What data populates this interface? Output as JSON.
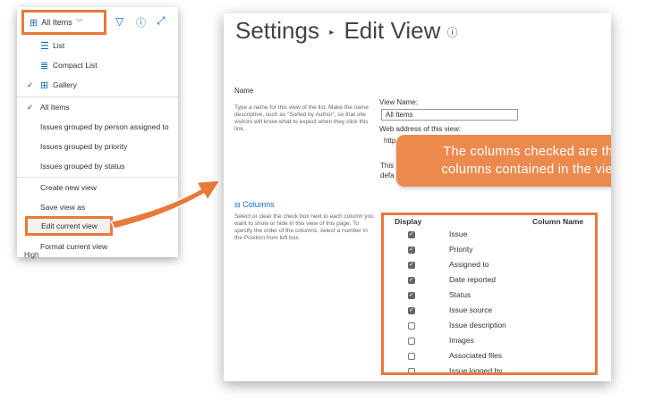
{
  "toolbar": {
    "view_label": "All Items"
  },
  "menu": {
    "items": [
      {
        "label": "List",
        "icon": "list-icon"
      },
      {
        "label": "Compact List",
        "icon": "compact-list-icon"
      },
      {
        "label": "Gallery",
        "icon": "gallery-icon",
        "checked": true
      },
      {
        "label": "All Items",
        "checked": true
      },
      {
        "label": "Issues grouped by person assigned to"
      },
      {
        "label": "Issues grouped by priority"
      },
      {
        "label": "Issues grouped by status"
      },
      {
        "label": "Create new view"
      },
      {
        "label": "Save view as"
      },
      {
        "label": "Edit current view"
      },
      {
        "label": "Format current view"
      }
    ],
    "peek_text": "High"
  },
  "settings": {
    "title": "Settings",
    "subtitle": "Edit View",
    "name_section": {
      "heading": "Name",
      "description": "Type a name for this view of the list. Make the name descriptive, such as \"Sorted by Author\", so that site visitors will know what to expect when they click this link.",
      "view_name_label": "View Name:",
      "view_name_value": "All Items",
      "web_address_label": "Web address of this view:",
      "web_address_partial": "http",
      "partial_line1": "This",
      "partial_line2": "defa"
    },
    "columns_section": {
      "heading": "Columns",
      "description": "Select or clear the check box next to each column you want to show or hide in this view of this page. To specify the order of the columns, select a number in the Position from left box.",
      "display_header": "Display",
      "column_name_header": "Column Name",
      "rows": [
        {
          "name": "Issue",
          "checked": true
        },
        {
          "name": "Priority",
          "checked": true
        },
        {
          "name": "Assigned to",
          "checked": true
        },
        {
          "name": "Date reported",
          "checked": true
        },
        {
          "name": "Status",
          "checked": true
        },
        {
          "name": "Issue source",
          "checked": true
        },
        {
          "name": "Issue description",
          "checked": false
        },
        {
          "name": "Images",
          "checked": false
        },
        {
          "name": "Associated files",
          "checked": false
        },
        {
          "name": "Issue logged by",
          "checked": false
        }
      ]
    }
  },
  "callout": {
    "line1": "The columns checked are the",
    "line2": "columns contained in the view"
  },
  "colors": {
    "highlight": "#e8793a",
    "callout_bg": "#ec8a4e",
    "accent": "#0f6cbd"
  }
}
